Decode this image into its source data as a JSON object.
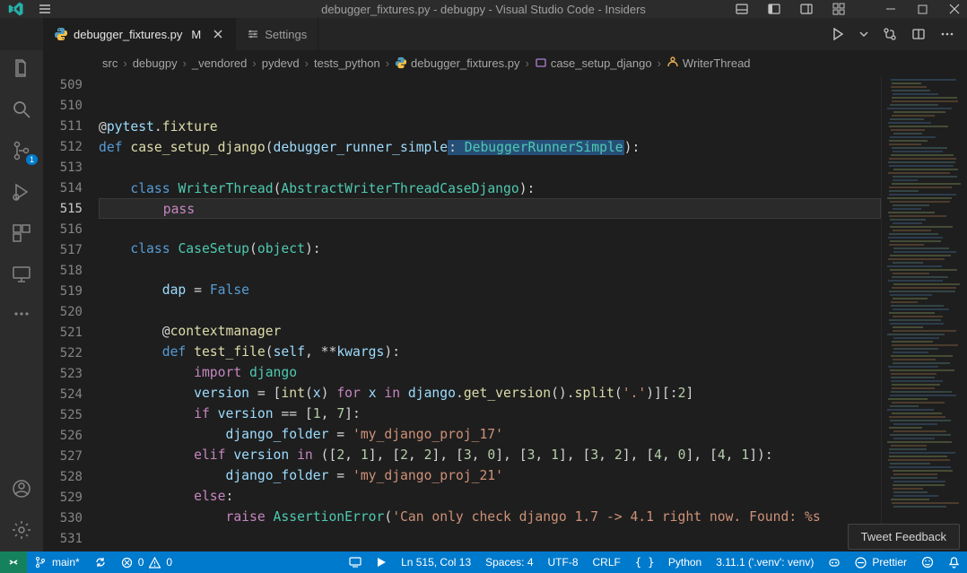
{
  "title": "debugger_fixtures.py - debugpy - Visual Studio Code - Insiders",
  "tabs": [
    {
      "icon": "python-file-icon",
      "label": "debugger_fixtures.py",
      "modified": "M",
      "active": true
    },
    {
      "icon": "settings-icon",
      "label": "Settings",
      "modified": "",
      "active": false
    }
  ],
  "breadcrumbs": [
    "src",
    "debugpy",
    "_vendored",
    "pydevd",
    "tests_python",
    "debugger_fixtures.py",
    "case_setup_django",
    "WriterThread"
  ],
  "activity_badge": "1",
  "gutter_start": 509,
  "editor_lines": [
    {
      "n": 509,
      "html": ""
    },
    {
      "n": 510,
      "html": ""
    },
    {
      "n": 511,
      "html": "<span class='tk-op'>@</span><span class='tk-prm'>pytest</span><span class='tk-op'>.</span><span class='tk-deco'>fixture</span>"
    },
    {
      "n": 512,
      "html": "<span class='tk-kw'>def</span> <span class='tk-fn'>case_setup_django</span>(<span class='tk-prm'>debugger_runner_simple</span><span class='tk-annot-box'>: <span class='tk-cls'>DebuggerRunnerSimple</span></span>):"
    },
    {
      "n": 513,
      "html": ""
    },
    {
      "n": 514,
      "html": "    <span class='tk-kw'>class</span> <span class='tk-cls'>WriterThread</span>(<span class='tk-cls'>AbstractWriterThreadCaseDjango</span>):"
    },
    {
      "n": 515,
      "html": "        <span class='tk-kw2'>pass</span>",
      "current": true
    },
    {
      "n": 516,
      "html": ""
    },
    {
      "n": 517,
      "html": "    <span class='tk-kw'>class</span> <span class='tk-cls'>CaseSetup</span>(<span class='tk-cls'>object</span>):"
    },
    {
      "n": 518,
      "html": ""
    },
    {
      "n": 519,
      "html": "        <span class='tk-prm'>dap</span> = <span class='tk-const'>False</span>"
    },
    {
      "n": 520,
      "html": ""
    },
    {
      "n": 521,
      "html": "        <span class='tk-op'>@</span><span class='tk-deco'>contextmanager</span>"
    },
    {
      "n": 522,
      "html": "        <span class='tk-kw'>def</span> <span class='tk-fn'>test_file</span>(<span class='tk-self'>self</span>, **<span class='tk-prm'>kwargs</span>):"
    },
    {
      "n": 523,
      "html": "            <span class='tk-kw2'>import</span> <span class='tk-cls'>django</span>"
    },
    {
      "n": 524,
      "html": "            <span class='tk-prm'>version</span> = [<span class='tk-fn'>int</span>(<span class='tk-prm'>x</span>) <span class='tk-kw2'>for</span> <span class='tk-prm'>x</span> <span class='tk-kw2'>in</span> <span class='tk-prm'>django</span>.<span class='tk-fn'>get_version</span>().<span class='tk-fn'>split</span>(<span class='tk-str'>'.'</span>)][:<span class='tk-num'>2</span>]"
    },
    {
      "n": 525,
      "html": "            <span class='tk-kw2'>if</span> <span class='tk-prm'>version</span> == [<span class='tk-num'>1</span>, <span class='tk-num'>7</span>]:"
    },
    {
      "n": 526,
      "html": "                <span class='tk-prm'>django_folder</span> = <span class='tk-str'>'my_django_proj_17'</span>"
    },
    {
      "n": 527,
      "html": "            <span class='tk-kw2'>elif</span> <span class='tk-prm'>version</span> <span class='tk-kw2'>in</span> ([<span class='tk-num'>2</span>, <span class='tk-num'>1</span>], [<span class='tk-num'>2</span>, <span class='tk-num'>2</span>], [<span class='tk-num'>3</span>, <span class='tk-num'>0</span>], [<span class='tk-num'>3</span>, <span class='tk-num'>1</span>], [<span class='tk-num'>3</span>, <span class='tk-num'>2</span>], [<span class='tk-num'>4</span>, <span class='tk-num'>0</span>], [<span class='tk-num'>4</span>, <span class='tk-num'>1</span>]):"
    },
    {
      "n": 528,
      "html": "                <span class='tk-prm'>django_folder</span> = <span class='tk-str'>'my_django_proj_21'</span>"
    },
    {
      "n": 529,
      "html": "            <span class='tk-kw2'>else</span>:"
    },
    {
      "n": 530,
      "html": "                <span class='tk-kw2'>raise</span> <span class='tk-cls'>AssertionError</span>(<span class='tk-str'>'Can only check django 1.7 -> 4.1 right now. Found: %s</span>"
    },
    {
      "n": 531,
      "html": ""
    }
  ],
  "status": {
    "branch": "main*",
    "errors": "0",
    "warnings": "0",
    "cursor": "Ln 515, Col 13",
    "spaces": "Spaces: 4",
    "encoding": "UTF-8",
    "eol": "CRLF",
    "lang": "Python",
    "interp": "3.11.1 ('.venv': venv)",
    "prettier": "Prettier"
  },
  "tweet_feedback": "Tweet Feedback"
}
